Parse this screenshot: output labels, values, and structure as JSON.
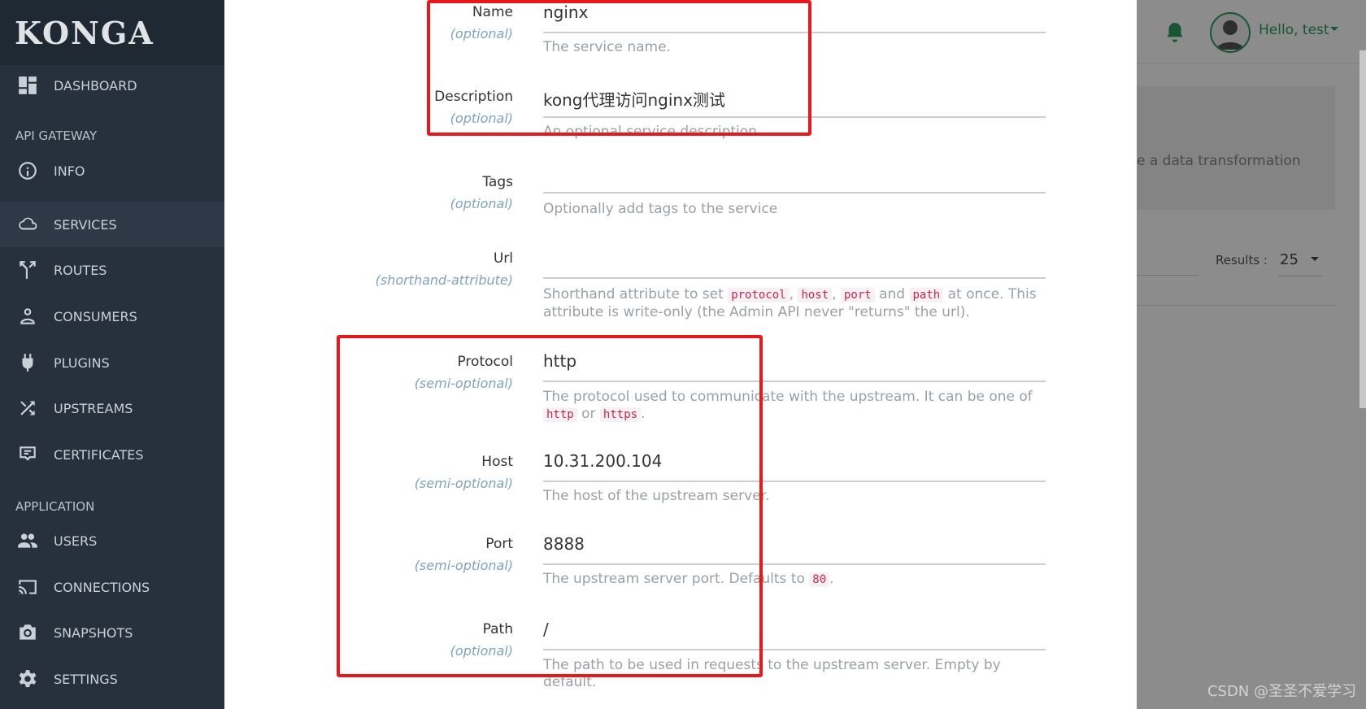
{
  "sidebar": {
    "logo": "KONGA",
    "sections": {
      "api_gateway": "API GATEWAY",
      "application": "APPLICATION"
    },
    "items": [
      {
        "label": "DASHBOARD",
        "icon": "dashboard-icon"
      },
      {
        "label": "INFO",
        "icon": "info-icon"
      },
      {
        "label": "SERVICES",
        "icon": "cloud-icon"
      },
      {
        "label": "ROUTES",
        "icon": "routes-icon"
      },
      {
        "label": "CONSUMERS",
        "icon": "user-icon"
      },
      {
        "label": "PLUGINS",
        "icon": "plug-icon"
      },
      {
        "label": "UPSTREAMS",
        "icon": "shuffle-icon"
      },
      {
        "label": "CERTIFICATES",
        "icon": "certificate-icon"
      },
      {
        "label": "USERS",
        "icon": "users-icon"
      },
      {
        "label": "CONNECTIONS",
        "icon": "cast-icon"
      },
      {
        "label": "SNAPSHOTS",
        "icon": "camera-icon"
      },
      {
        "label": "SETTINGS",
        "icon": "gear-icon"
      }
    ]
  },
  "header": {
    "greeting": "Hello, test"
  },
  "background": {
    "text_snippet": "e a data transformation",
    "results_label": "Results :",
    "results_value": "25"
  },
  "form": {
    "name": {
      "label": "Name",
      "sub": "(optional)",
      "value": "nginx",
      "help": "The service name."
    },
    "description": {
      "label": "Description",
      "sub": "(optional)",
      "value": "kong代理访问nginx测试",
      "help": "An optional service description."
    },
    "tags": {
      "label": "Tags",
      "sub": "(optional)",
      "value": "",
      "help": "Optionally add tags to the service"
    },
    "url": {
      "label": "Url",
      "sub": "(shorthand-attribute)",
      "value": "",
      "help_pre": "Shorthand attribute to set",
      "c1": "protocol",
      "c2": "host",
      "c3": "port",
      "and": "and",
      "c4": "path",
      "help_post": "at once. This attribute is write-only (the Admin API never \"returns\" the url)."
    },
    "protocol": {
      "label": "Protocol",
      "sub": "(semi-optional)",
      "value": "http",
      "help_pre": "The protocol used to communicate with the upstream. It can be one of",
      "c1": "http",
      "or": "or",
      "c2": "https",
      "end": "."
    },
    "host": {
      "label": "Host",
      "sub": "(semi-optional)",
      "value": "10.31.200.104",
      "help": "The host of the upstream server."
    },
    "port": {
      "label": "Port",
      "sub": "(semi-optional)",
      "value": "8888",
      "help_pre": "The upstream server port. Defaults to",
      "c1": "80",
      "end": "."
    },
    "path": {
      "label": "Path",
      "sub": "(optional)",
      "value": "/",
      "help": "The path to be used in requests to the upstream server. Empty by default."
    }
  },
  "watermark": "CSDN @圣圣不爱学习",
  "colors": {
    "sidebar": "#26313d",
    "accent": "#2a9d5c",
    "highlight": "#e8191c"
  }
}
